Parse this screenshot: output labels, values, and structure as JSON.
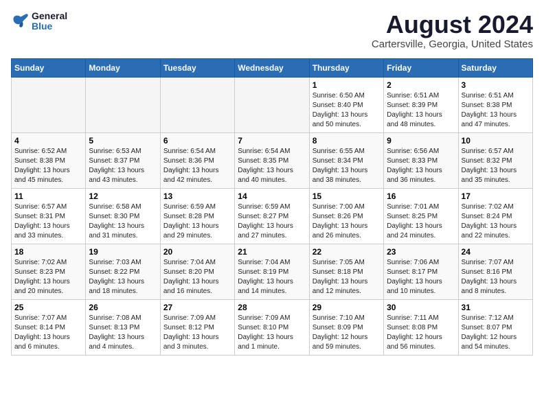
{
  "logo": {
    "line1": "General",
    "line2": "Blue"
  },
  "title": "August 2024",
  "subtitle": "Cartersville, Georgia, United States",
  "days_of_week": [
    "Sunday",
    "Monday",
    "Tuesday",
    "Wednesday",
    "Thursday",
    "Friday",
    "Saturday"
  ],
  "weeks": [
    [
      {
        "day": "",
        "empty": true
      },
      {
        "day": "",
        "empty": true
      },
      {
        "day": "",
        "empty": true
      },
      {
        "day": "",
        "empty": true
      },
      {
        "day": "1",
        "sunrise": "Sunrise: 6:50 AM",
        "sunset": "Sunset: 8:40 PM",
        "daylight": "Daylight: 13 hours and 50 minutes."
      },
      {
        "day": "2",
        "sunrise": "Sunrise: 6:51 AM",
        "sunset": "Sunset: 8:39 PM",
        "daylight": "Daylight: 13 hours and 48 minutes."
      },
      {
        "day": "3",
        "sunrise": "Sunrise: 6:51 AM",
        "sunset": "Sunset: 8:38 PM",
        "daylight": "Daylight: 13 hours and 47 minutes."
      }
    ],
    [
      {
        "day": "4",
        "sunrise": "Sunrise: 6:52 AM",
        "sunset": "Sunset: 8:38 PM",
        "daylight": "Daylight: 13 hours and 45 minutes."
      },
      {
        "day": "5",
        "sunrise": "Sunrise: 6:53 AM",
        "sunset": "Sunset: 8:37 PM",
        "daylight": "Daylight: 13 hours and 43 minutes."
      },
      {
        "day": "6",
        "sunrise": "Sunrise: 6:54 AM",
        "sunset": "Sunset: 8:36 PM",
        "daylight": "Daylight: 13 hours and 42 minutes."
      },
      {
        "day": "7",
        "sunrise": "Sunrise: 6:54 AM",
        "sunset": "Sunset: 8:35 PM",
        "daylight": "Daylight: 13 hours and 40 minutes."
      },
      {
        "day": "8",
        "sunrise": "Sunrise: 6:55 AM",
        "sunset": "Sunset: 8:34 PM",
        "daylight": "Daylight: 13 hours and 38 minutes."
      },
      {
        "day": "9",
        "sunrise": "Sunrise: 6:56 AM",
        "sunset": "Sunset: 8:33 PM",
        "daylight": "Daylight: 13 hours and 36 minutes."
      },
      {
        "day": "10",
        "sunrise": "Sunrise: 6:57 AM",
        "sunset": "Sunset: 8:32 PM",
        "daylight": "Daylight: 13 hours and 35 minutes."
      }
    ],
    [
      {
        "day": "11",
        "sunrise": "Sunrise: 6:57 AM",
        "sunset": "Sunset: 8:31 PM",
        "daylight": "Daylight: 13 hours and 33 minutes."
      },
      {
        "day": "12",
        "sunrise": "Sunrise: 6:58 AM",
        "sunset": "Sunset: 8:30 PM",
        "daylight": "Daylight: 13 hours and 31 minutes."
      },
      {
        "day": "13",
        "sunrise": "Sunrise: 6:59 AM",
        "sunset": "Sunset: 8:28 PM",
        "daylight": "Daylight: 13 hours and 29 minutes."
      },
      {
        "day": "14",
        "sunrise": "Sunrise: 6:59 AM",
        "sunset": "Sunset: 8:27 PM",
        "daylight": "Daylight: 13 hours and 27 minutes."
      },
      {
        "day": "15",
        "sunrise": "Sunrise: 7:00 AM",
        "sunset": "Sunset: 8:26 PM",
        "daylight": "Daylight: 13 hours and 26 minutes."
      },
      {
        "day": "16",
        "sunrise": "Sunrise: 7:01 AM",
        "sunset": "Sunset: 8:25 PM",
        "daylight": "Daylight: 13 hours and 24 minutes."
      },
      {
        "day": "17",
        "sunrise": "Sunrise: 7:02 AM",
        "sunset": "Sunset: 8:24 PM",
        "daylight": "Daylight: 13 hours and 22 minutes."
      }
    ],
    [
      {
        "day": "18",
        "sunrise": "Sunrise: 7:02 AM",
        "sunset": "Sunset: 8:23 PM",
        "daylight": "Daylight: 13 hours and 20 minutes."
      },
      {
        "day": "19",
        "sunrise": "Sunrise: 7:03 AM",
        "sunset": "Sunset: 8:22 PM",
        "daylight": "Daylight: 13 hours and 18 minutes."
      },
      {
        "day": "20",
        "sunrise": "Sunrise: 7:04 AM",
        "sunset": "Sunset: 8:20 PM",
        "daylight": "Daylight: 13 hours and 16 minutes."
      },
      {
        "day": "21",
        "sunrise": "Sunrise: 7:04 AM",
        "sunset": "Sunset: 8:19 PM",
        "daylight": "Daylight: 13 hours and 14 minutes."
      },
      {
        "day": "22",
        "sunrise": "Sunrise: 7:05 AM",
        "sunset": "Sunset: 8:18 PM",
        "daylight": "Daylight: 13 hours and 12 minutes."
      },
      {
        "day": "23",
        "sunrise": "Sunrise: 7:06 AM",
        "sunset": "Sunset: 8:17 PM",
        "daylight": "Daylight: 13 hours and 10 minutes."
      },
      {
        "day": "24",
        "sunrise": "Sunrise: 7:07 AM",
        "sunset": "Sunset: 8:16 PM",
        "daylight": "Daylight: 13 hours and 8 minutes."
      }
    ],
    [
      {
        "day": "25",
        "sunrise": "Sunrise: 7:07 AM",
        "sunset": "Sunset: 8:14 PM",
        "daylight": "Daylight: 13 hours and 6 minutes."
      },
      {
        "day": "26",
        "sunrise": "Sunrise: 7:08 AM",
        "sunset": "Sunset: 8:13 PM",
        "daylight": "Daylight: 13 hours and 4 minutes."
      },
      {
        "day": "27",
        "sunrise": "Sunrise: 7:09 AM",
        "sunset": "Sunset: 8:12 PM",
        "daylight": "Daylight: 13 hours and 3 minutes."
      },
      {
        "day": "28",
        "sunrise": "Sunrise: 7:09 AM",
        "sunset": "Sunset: 8:10 PM",
        "daylight": "Daylight: 13 hours and 1 minute."
      },
      {
        "day": "29",
        "sunrise": "Sunrise: 7:10 AM",
        "sunset": "Sunset: 8:09 PM",
        "daylight": "Daylight: 12 hours and 59 minutes."
      },
      {
        "day": "30",
        "sunrise": "Sunrise: 7:11 AM",
        "sunset": "Sunset: 8:08 PM",
        "daylight": "Daylight: 12 hours and 56 minutes."
      },
      {
        "day": "31",
        "sunrise": "Sunrise: 7:12 AM",
        "sunset": "Sunset: 8:07 PM",
        "daylight": "Daylight: 12 hours and 54 minutes."
      }
    ]
  ]
}
